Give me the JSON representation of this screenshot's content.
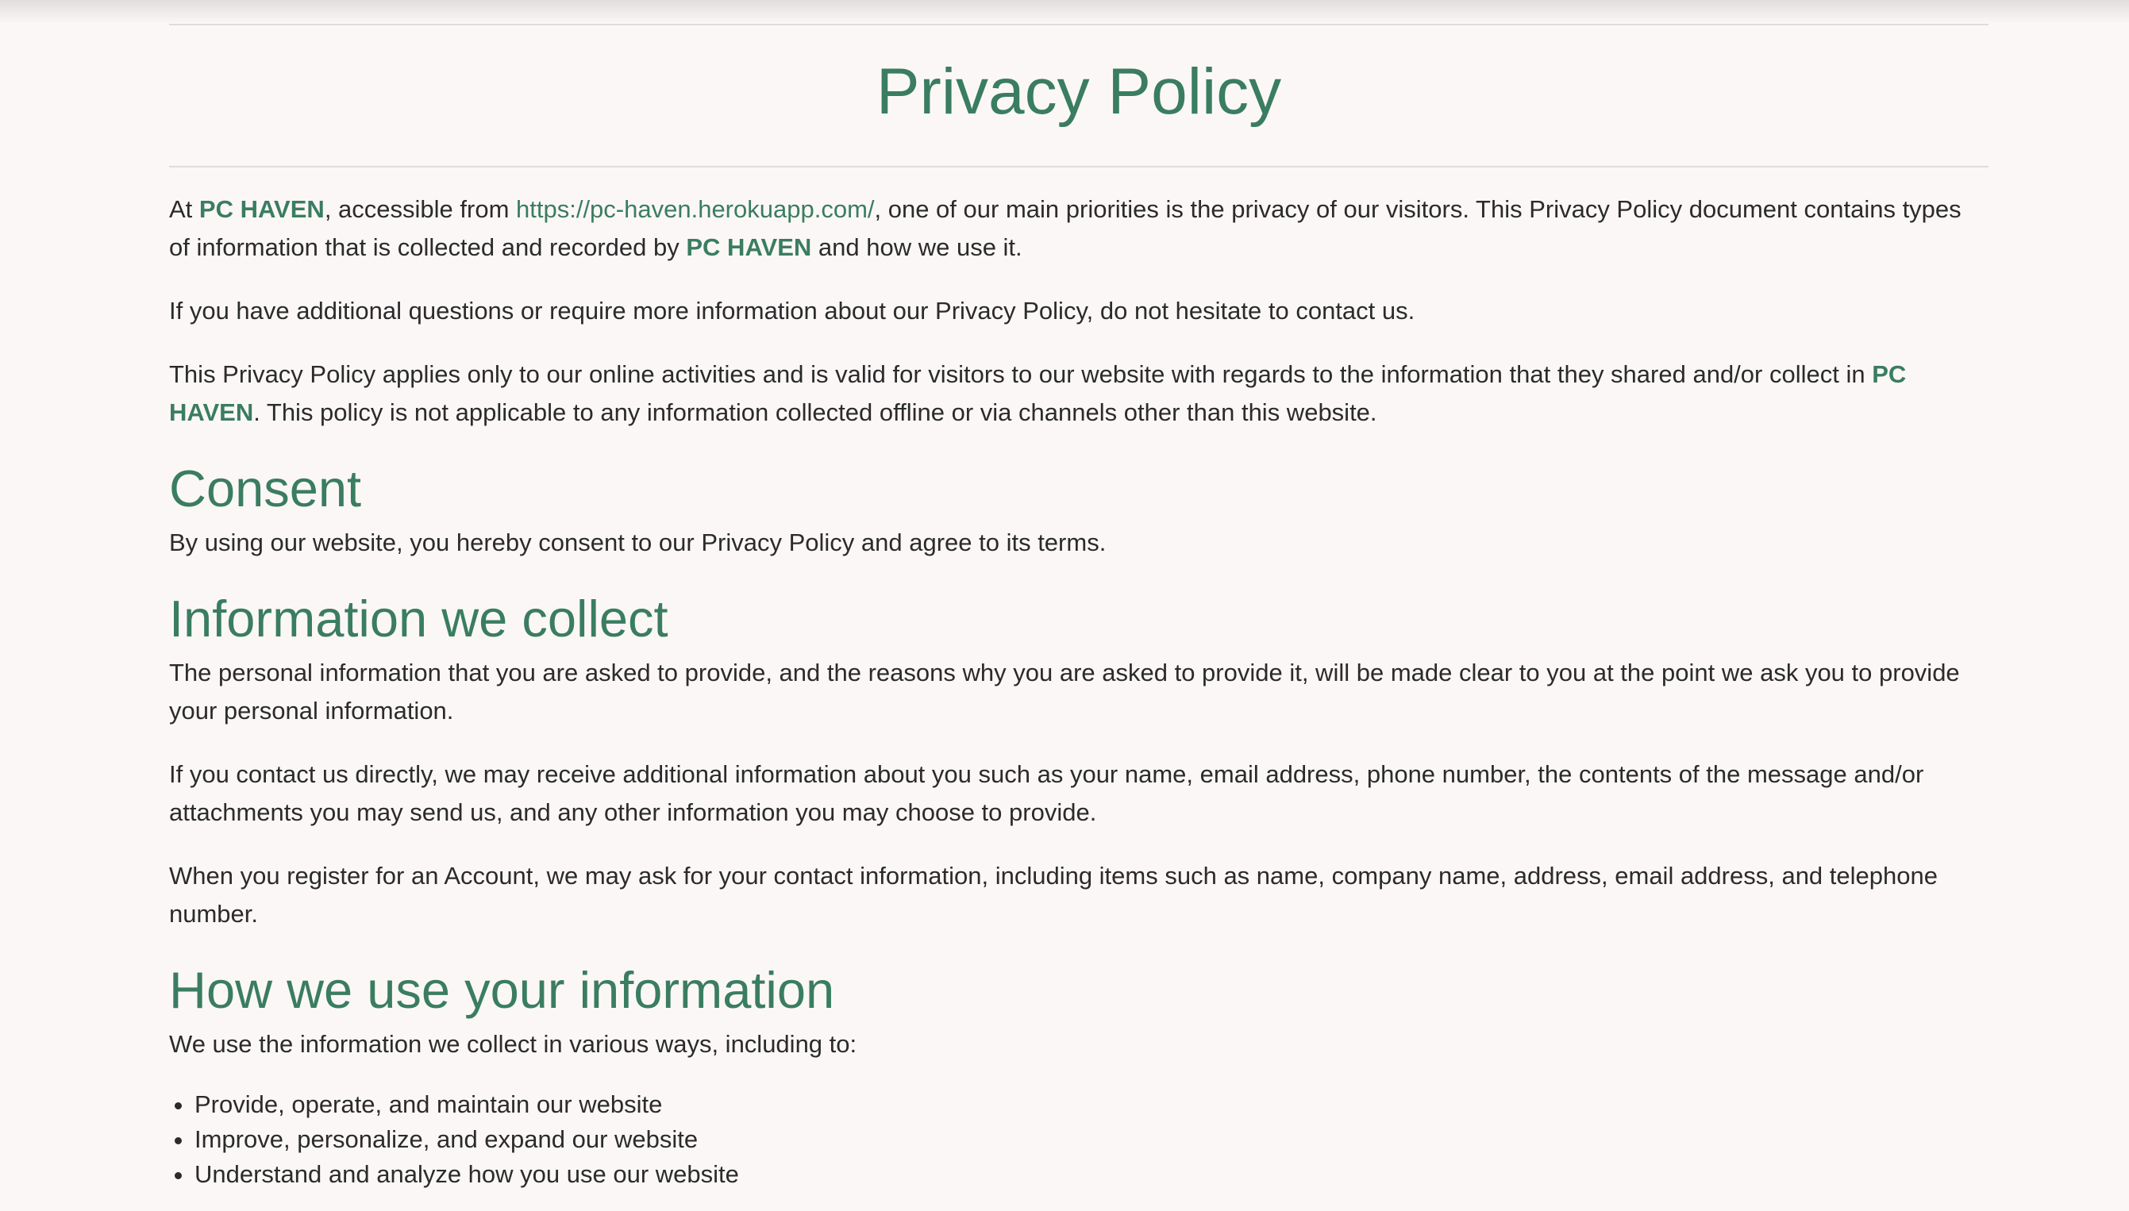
{
  "page": {
    "title": "Privacy Policy"
  },
  "brand": {
    "name": "PC HAVEN",
    "name_part1": "PC",
    "name_part2": "HAVEN",
    "url": "https://pc-haven.herokuapp.com/",
    "accent_color": "#3a7d61"
  },
  "intro": {
    "p1_prefix": "At ",
    "p1_mid": ", accessible from ",
    "p1_after_url": ", one of our main priorities is the privacy of our visitors. This Privacy Policy document contains types of information that is collected and recorded by ",
    "p1_suffix": " and how we use it.",
    "p2": "If you have additional questions or require more information about our Privacy Policy, do not hesitate to contact us.",
    "p3_prefix": "This Privacy Policy applies only to our online activities and is valid for visitors to our website with regards to the information that they shared and/or collect in ",
    "p3_suffix": ". This policy is not applicable to any information collected offline or via channels other than this website."
  },
  "sections": {
    "consent": {
      "heading": "Consent",
      "p1": "By using our website, you hereby consent to our Privacy Policy and agree to its terms."
    },
    "collect": {
      "heading": "Information we collect",
      "p1": "The personal information that you are asked to provide, and the reasons why you are asked to provide it, will be made clear to you at the point we ask you to provide your personal information.",
      "p2": "If you contact us directly, we may receive additional information about you such as your name, email address, phone number, the contents of the message and/or attachments you may send us, and any other information you may choose to provide.",
      "p3": "When you register for an Account, we may ask for your contact information, including items such as name, company name, address, email address, and telephone number."
    },
    "use": {
      "heading": "How we use your information",
      "p1": "We use the information we collect in various ways, including to:",
      "items": [
        "Provide, operate, and maintain our website",
        "Improve, personalize, and expand our website",
        "Understand and analyze how you use our website"
      ]
    }
  }
}
